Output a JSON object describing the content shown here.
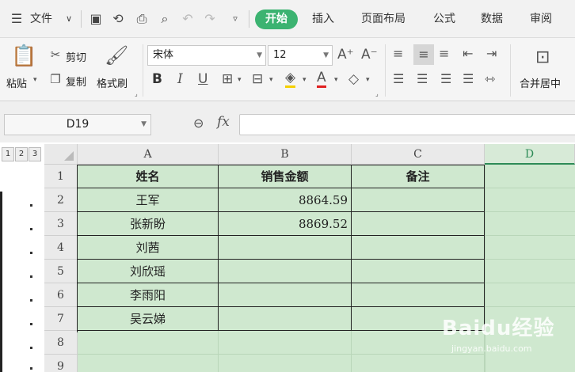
{
  "menubar": {
    "file_label": "文件",
    "tabs": [
      {
        "label": "开始",
        "active": true
      },
      {
        "label": "插入"
      },
      {
        "label": "页面布局"
      },
      {
        "label": "公式"
      },
      {
        "label": "数据"
      },
      {
        "label": "审阅"
      }
    ],
    "accent_color": "#3cb371"
  },
  "ribbon": {
    "paste_label": "粘贴",
    "cut_label": "剪切",
    "copy_label": "复制",
    "format_painter_label": "格式刷",
    "font_name": "宋体",
    "font_size": "12",
    "merge_center_label": "合并居中"
  },
  "formula_bar": {
    "name_box": "D19",
    "fx_label": "fx",
    "formula_value": ""
  },
  "outline": {
    "levels": [
      "1",
      "2",
      "3"
    ]
  },
  "sheet": {
    "columns": [
      "A",
      "B",
      "C",
      "D"
    ],
    "rows": [
      "1",
      "2",
      "3",
      "4",
      "5",
      "6",
      "7",
      "8",
      "9"
    ],
    "selected_column": "D",
    "cells": {
      "A1": "姓名",
      "B1": "销售金额",
      "C1": "备注",
      "A2": "王军",
      "B2": "8864.59",
      "C2": "",
      "A3": "张新盼",
      "B3": "8869.52",
      "C3": "",
      "A4": "刘茜",
      "B4": "",
      "C4": "",
      "A5": "刘欣瑶",
      "B5": "",
      "C5": "",
      "A6": "李雨阳",
      "B6": "",
      "C6": "",
      "A7": "吴云娣",
      "B7": "",
      "C7": ""
    },
    "fill_color": "#cfe8cf"
  },
  "watermark": {
    "brand": "Baidu经验",
    "url": "jingyan.baidu.com"
  }
}
